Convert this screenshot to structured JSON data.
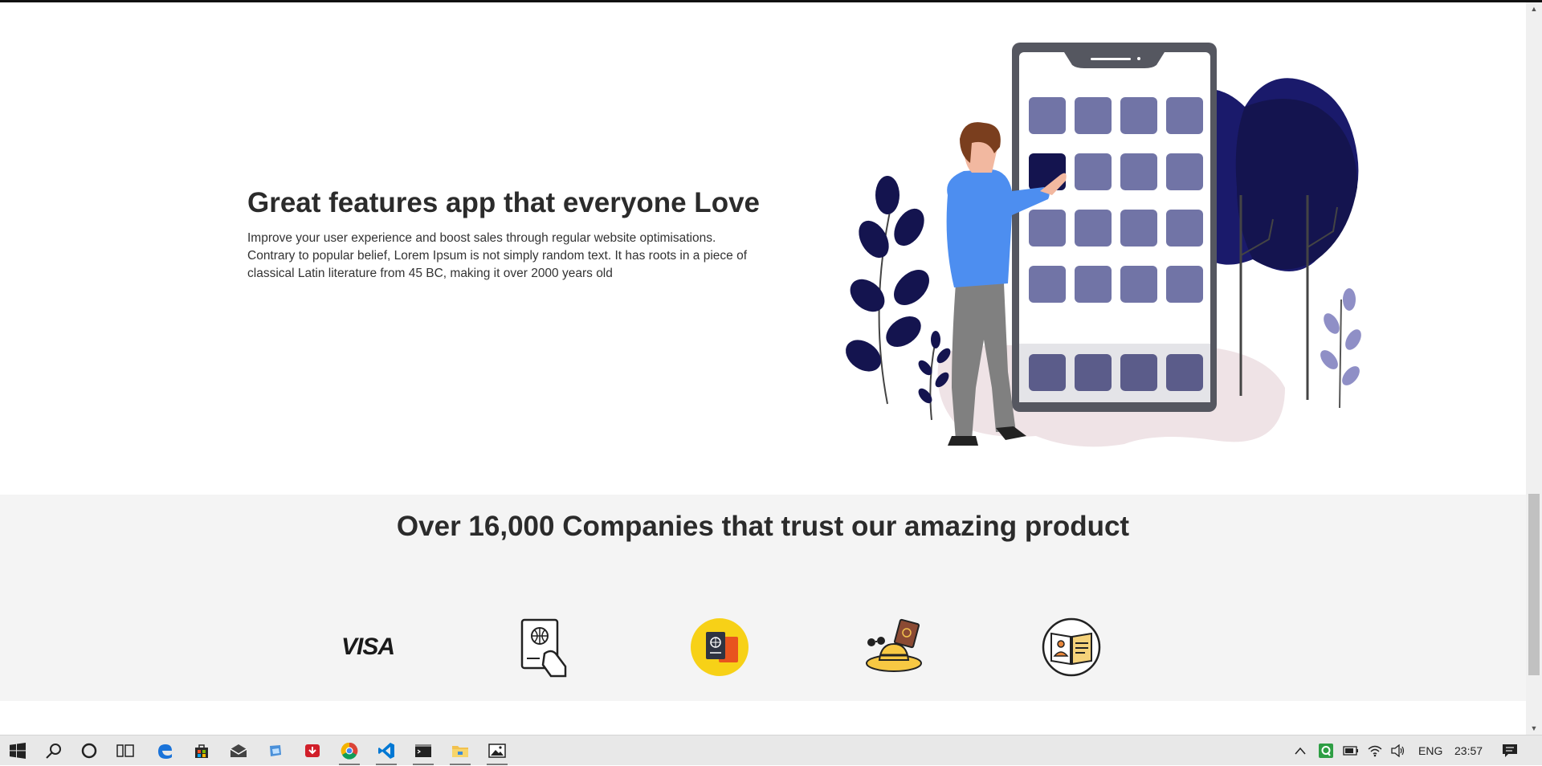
{
  "feature": {
    "title": "Great features app that everyone Love",
    "description": "Improve your user experience and boost sales through regular website optimisations. Contrary to popular belief, Lorem Ipsum is not simply random text. It has roots in a piece of classical Latin literature from 45 BC, making it over 2000 years old"
  },
  "trust": {
    "title": "Over 16,000 Companies that trust our amazing product",
    "logos": [
      {
        "name": "visa-logo",
        "text": "VISA"
      },
      {
        "name": "passport-hand-icon"
      },
      {
        "name": "passport-circle-icon"
      },
      {
        "name": "travel-hat-icon"
      },
      {
        "name": "id-book-icon"
      }
    ]
  },
  "taskbar": {
    "language": "ENG",
    "time": "23:57"
  },
  "colors": {
    "heading": "#2b2b2b",
    "band": "#f4f4f4",
    "navy": "#14144f",
    "tile": "#7174a6",
    "shirt": "#4d8ef0"
  }
}
